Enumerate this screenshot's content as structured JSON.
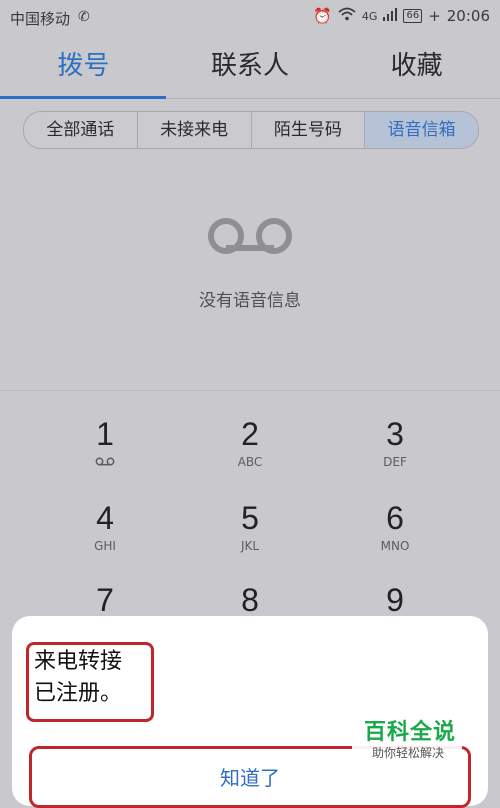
{
  "status_bar": {
    "carrier": "中国移动",
    "call_icon": "phone-call-icon",
    "network": "4G",
    "battery": "66",
    "time": "20:06"
  },
  "tabs": [
    {
      "label": "拨号",
      "active": true
    },
    {
      "label": "联系人",
      "active": false
    },
    {
      "label": "收藏",
      "active": false
    }
  ],
  "filters": [
    {
      "label": "全部通话",
      "selected": false
    },
    {
      "label": "未接来电",
      "selected": false
    },
    {
      "label": "陌生号码",
      "selected": false
    },
    {
      "label": "语音信箱",
      "selected": true
    }
  ],
  "empty_state": {
    "icon": "voicemail-icon",
    "text": "没有语音信息"
  },
  "dialpad": [
    {
      "digit": "1",
      "letters": ""
    },
    {
      "digit": "2",
      "letters": "ABC"
    },
    {
      "digit": "3",
      "letters": "DEF"
    },
    {
      "digit": "4",
      "letters": "GHI"
    },
    {
      "digit": "5",
      "letters": "JKL"
    },
    {
      "digit": "6",
      "letters": "MNO"
    },
    {
      "digit": "7",
      "letters": ""
    },
    {
      "digit": "8",
      "letters": ""
    },
    {
      "digit": "9",
      "letters": ""
    }
  ],
  "dialog": {
    "message_line1": "来电转接",
    "message_line2": "已注册。",
    "button": "知道了"
  },
  "watermark": {
    "title": "百科全说",
    "subtitle": "助你轻松解决"
  },
  "colors": {
    "accent": "#2f6fc1",
    "highlight_border": "#c0272d",
    "watermark_green": "#1ba84a"
  }
}
